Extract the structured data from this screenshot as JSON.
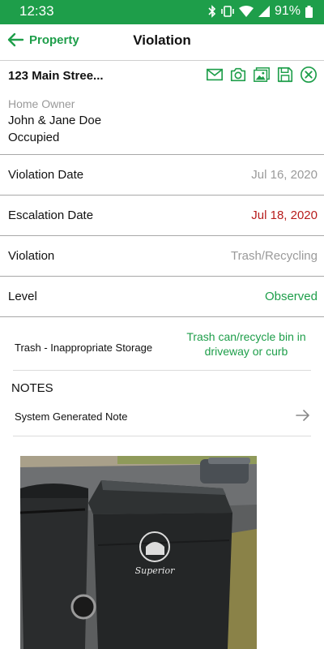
{
  "status": {
    "time": "12:33",
    "battery": "91%"
  },
  "appbar": {
    "back_label": "Property",
    "title": "Violation"
  },
  "property": {
    "address": "123 Main Stree...",
    "owner_label": "Home Owner",
    "owner_name": "John & Jane Doe",
    "occupancy": "Occupied"
  },
  "actions": [
    "mail-icon",
    "camera-icon",
    "image-icon",
    "save-icon",
    "close-circle-icon"
  ],
  "fields": {
    "violation_date": {
      "label": "Violation Date",
      "value": "Jul 16, 2020"
    },
    "escalation_date": {
      "label": "Escalation Date",
      "value": "Jul 18, 2020"
    },
    "violation": {
      "label": "Violation",
      "value": "Trash/Recycling"
    },
    "level": {
      "label": "Level",
      "value": "Observed"
    }
  },
  "detail": {
    "category": "Trash - Inappropriate Storage",
    "description": "Trash can/recycle bin in driveway or curb"
  },
  "notes": {
    "heading": "NOTES",
    "items": [
      {
        "label": "System Generated Note"
      }
    ]
  },
  "photo": {
    "logo_text": "Superior"
  },
  "colors": {
    "accent": "#1e9e4a",
    "overdue": "#b71c1c",
    "muted": "#9a9a9a"
  }
}
